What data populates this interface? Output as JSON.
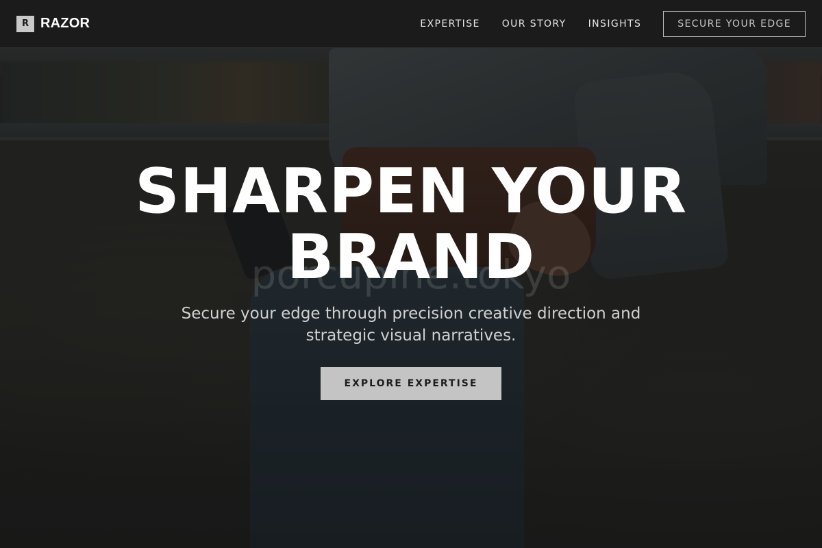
{
  "header": {
    "logo_mark": "R",
    "brand_name": "RAZOR",
    "nav": [
      {
        "label": "EXPERTISE"
      },
      {
        "label": "OUR STORY"
      },
      {
        "label": "INSIGHTS"
      }
    ],
    "cta_label": "SECURE YOUR EDGE"
  },
  "hero": {
    "title": "SHARPEN YOUR BRAND",
    "subtitle": "Secure your edge through precision creative direction and strategic visual narratives.",
    "cta_label": "EXPLORE EXPERTISE",
    "watermark": "porcupine.tokyo",
    "background_image": "person-in-denim-jacket-photo"
  },
  "colors": {
    "header_bg": "#1b1b1b",
    "text_primary": "#ffffff",
    "button_bg": "#c4c4c4",
    "button_text": "#1e1e1e"
  }
}
